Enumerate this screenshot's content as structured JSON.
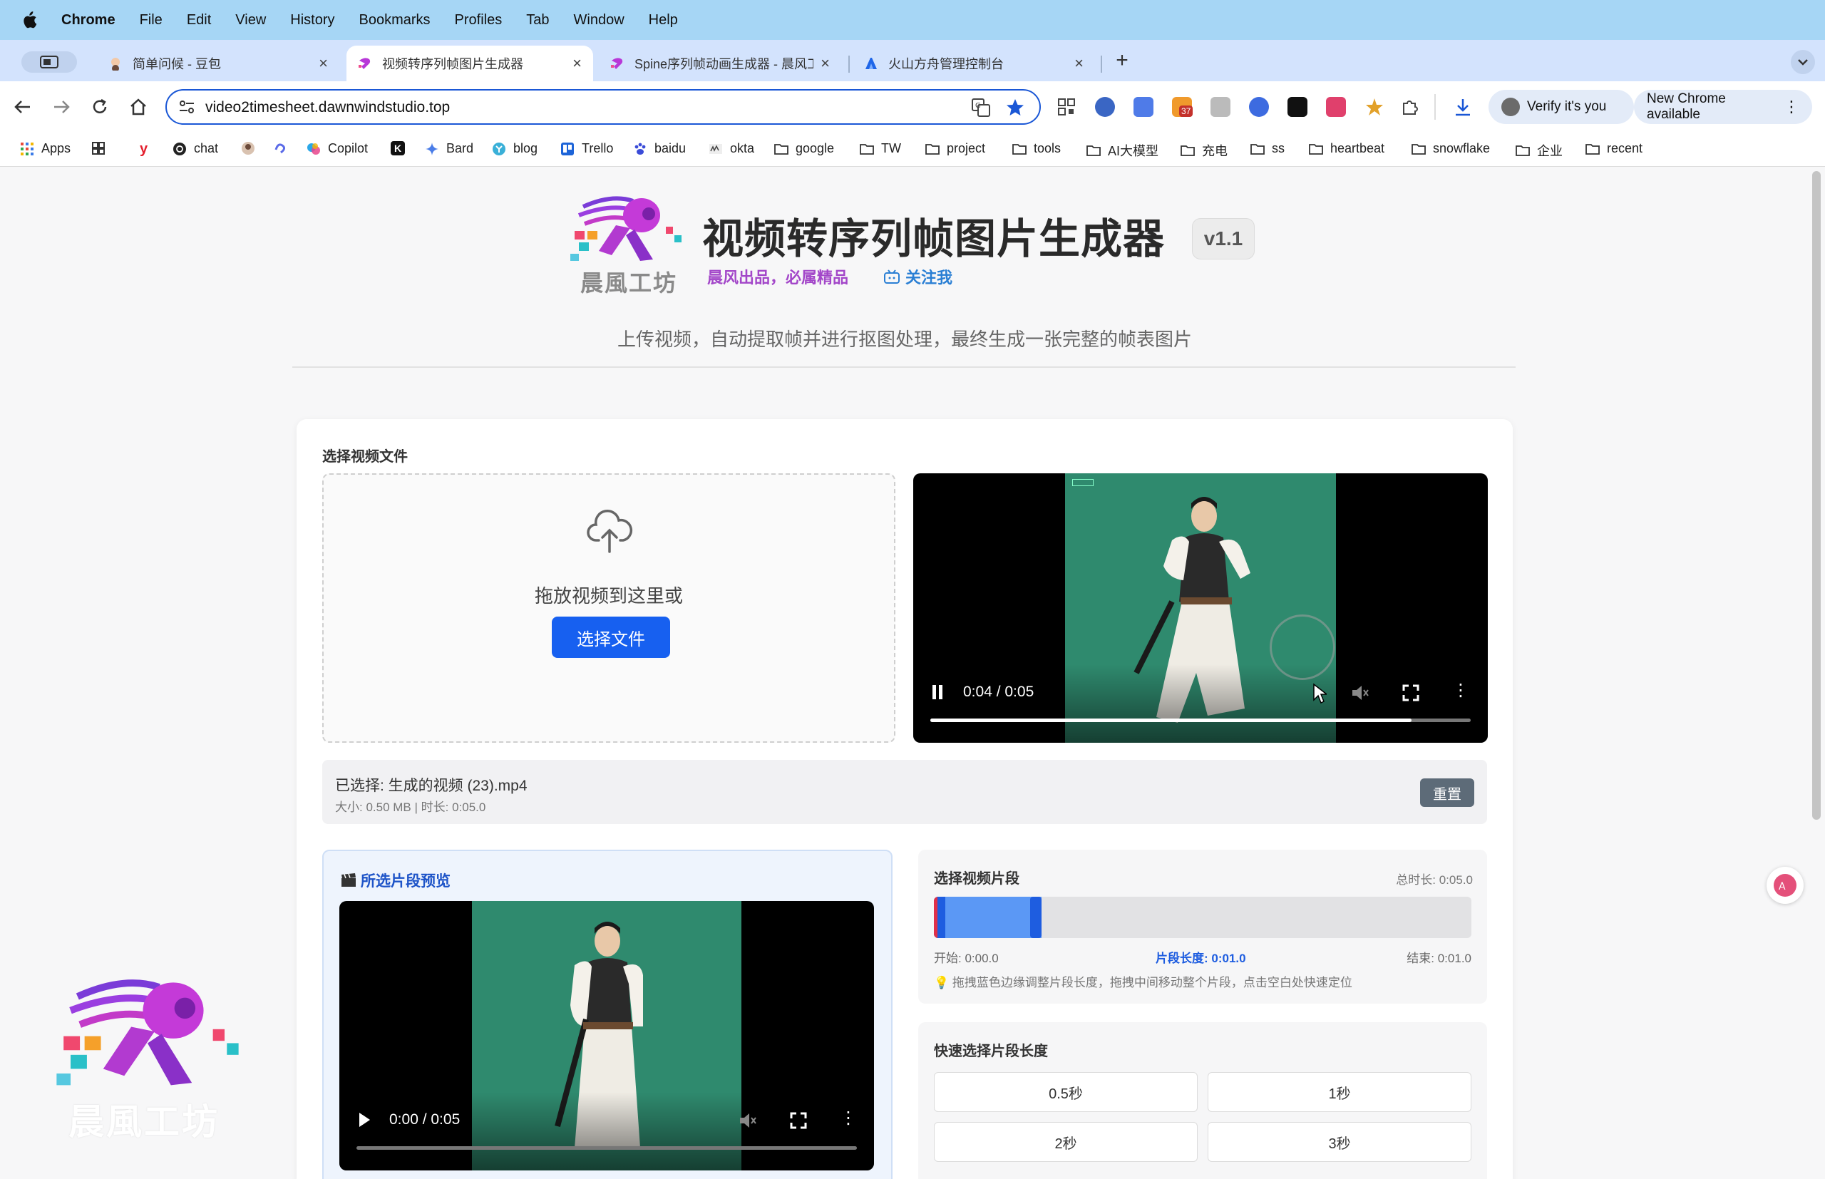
{
  "menubar": {
    "app": "Chrome",
    "items": [
      "File",
      "Edit",
      "View",
      "History",
      "Bookmarks",
      "Profiles",
      "Tab",
      "Window",
      "Help"
    ]
  },
  "tabs": [
    {
      "title": "简单问候 - 豆包",
      "icon": "doubao-icon",
      "active": false
    },
    {
      "title": "视频转序列帧图片生成器",
      "icon": "dawnwind-icon",
      "active": true
    },
    {
      "title": "Spine序列帧动画生成器 - 晨风工坊",
      "icon": "dawnwind-icon",
      "active": false
    },
    {
      "title": "火山方舟管理控制台",
      "icon": "volcano-icon",
      "active": false
    }
  ],
  "omnibox": {
    "url": "video2timesheet.dawnwindstudio.top"
  },
  "toolbar": {
    "extension_badge": "37",
    "verify_label": "Verify it's you",
    "update_label": "New Chrome available"
  },
  "bookmarks": [
    {
      "label": "Apps",
      "icon": "apps-grid-icon"
    },
    {
      "label": "",
      "icon": "tab-groups-icon"
    },
    {
      "label": "",
      "icon": "y-logo-icon"
    },
    {
      "label": "chat",
      "icon": "openai-icon"
    },
    {
      "label": "",
      "icon": "avatar-icon"
    },
    {
      "label": "",
      "icon": "swirl-icon"
    },
    {
      "label": "Copilot",
      "icon": "copilot-icon"
    },
    {
      "label": "",
      "icon": "k-logo-icon"
    },
    {
      "label": "Bard",
      "icon": "bard-sparkle-icon"
    },
    {
      "label": "blog",
      "icon": "blog-icon"
    },
    {
      "label": "Trello",
      "icon": "trello-icon"
    },
    {
      "label": "baidu",
      "icon": "baidu-paw-icon"
    },
    {
      "label": "okta",
      "icon": "okta-icon"
    },
    {
      "label": "google",
      "icon": "folder-icon"
    },
    {
      "label": "TW",
      "icon": "folder-icon"
    },
    {
      "label": "project",
      "icon": "folder-icon"
    },
    {
      "label": "tools",
      "icon": "folder-icon"
    },
    {
      "label": "AI大模型",
      "icon": "folder-icon"
    },
    {
      "label": "充电",
      "icon": "folder-icon"
    },
    {
      "label": "ss",
      "icon": "folder-icon"
    },
    {
      "label": "heartbeat",
      "icon": "folder-icon"
    },
    {
      "label": "snowflake",
      "icon": "folder-icon"
    },
    {
      "label": "企业",
      "icon": "folder-icon"
    },
    {
      "label": "recent",
      "icon": "folder-icon"
    }
  ],
  "header": {
    "title": "视频转序列帧图片生成器",
    "version": "v1.1",
    "logo_text": "晨風工坊",
    "slogan": "晨风出品，必属精品",
    "follow": "关注我",
    "subtitle": "上传视频，自动提取帧并进行抠图处理，最终生成一张完整的帧表图片"
  },
  "upload": {
    "label": "选择视频文件",
    "drop_text": "拖放视频到这里或",
    "choose_button": "选择文件"
  },
  "main_video": {
    "time": "0:04 / 0:05",
    "progress": 0.89,
    "playing": true
  },
  "file_info": {
    "name": "已选择: 生成的视频 (23).mp4",
    "meta": "大小: 0.50 MB | 时长: 0:05.0",
    "reset": "重置"
  },
  "preview": {
    "title": "所选片段预览",
    "time": "0:00 / 0:05",
    "progress": 0.0,
    "playing": false
  },
  "segment": {
    "title": "选择视频片段",
    "total": "总时长: 0:05.0",
    "start": "开始: 0:00.0",
    "length": "片段长度: 0:01.0",
    "end": "结束: 0:01.0",
    "tip": "拖拽蓝色边缘调整片段长度，拖拽中间移动整个片段，点击空白处快速定位",
    "selected_fraction": 0.2
  },
  "quick": {
    "title": "快速选择片段长度",
    "options": [
      "0.5秒",
      "1秒",
      "2秒",
      "3秒"
    ]
  },
  "watermark": {
    "text": "晨風工坊"
  },
  "colors": {
    "accent": "#1760f0",
    "green_screen": "#2f8a6e",
    "brand_purple": "#a347c9"
  }
}
